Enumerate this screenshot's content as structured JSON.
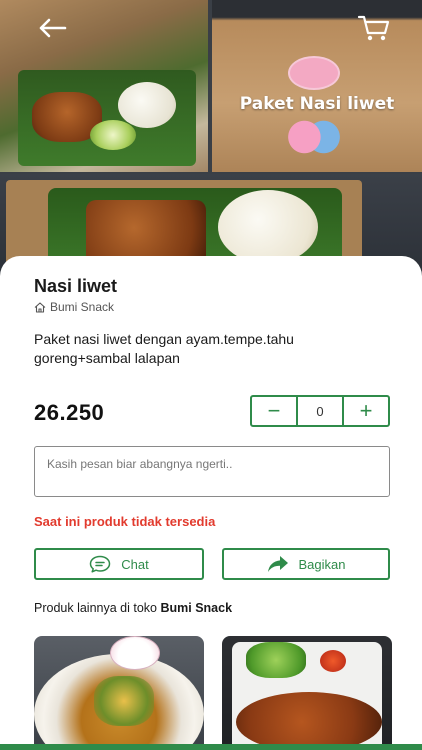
{
  "product": {
    "name": "Nasi liwet",
    "store": "Bumi Snack",
    "description": "Paket nasi liwet dengan ayam.tempe.tahu goreng+sambal lalapan",
    "price": "26.250",
    "image_caption": "Paket Nasi liwet"
  },
  "quantity": {
    "minus": "−",
    "value": "0",
    "plus": "+"
  },
  "note": {
    "placeholder": "Kasih pesan biar abangnya ngerti.."
  },
  "status": {
    "unavailable": "Saat ini produk tidak tersedia"
  },
  "actions": {
    "chat_label": "Chat",
    "share_label": "Bagikan"
  },
  "more_products": {
    "prefix": "Produk lainnya di toko",
    "store": "Bumi Snack"
  },
  "icons": {
    "back": "arrow-left-icon",
    "cart": "cart-icon",
    "store": "home-icon",
    "chat": "chat-bubble-icon",
    "share": "share-arrow-icon"
  },
  "colors": {
    "accent": "#2f8b4a",
    "error": "#e23b2e"
  }
}
